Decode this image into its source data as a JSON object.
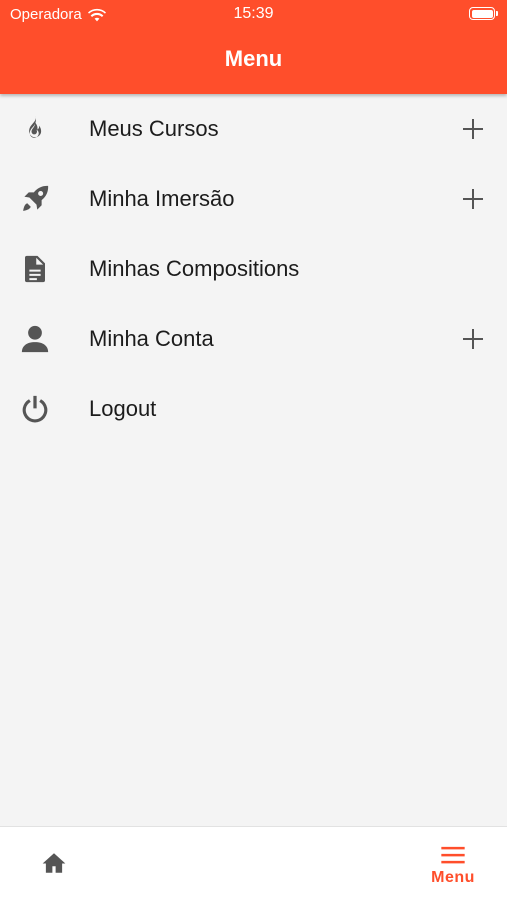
{
  "status_bar": {
    "carrier": "Operadora",
    "time": "15:39"
  },
  "header": {
    "title": "Menu"
  },
  "menu": {
    "items": [
      {
        "label": "Meus Cursos",
        "icon": "flame-icon",
        "expandable": true
      },
      {
        "label": "Minha Imersão",
        "icon": "rocket-icon",
        "expandable": true
      },
      {
        "label": "Minhas Compositions",
        "icon": "document-icon",
        "expandable": false
      },
      {
        "label": "Minha Conta",
        "icon": "user-icon",
        "expandable": true
      },
      {
        "label": "Logout",
        "icon": "power-icon",
        "expandable": false
      }
    ]
  },
  "tab_bar": {
    "home_icon": "home-icon",
    "menu_icon": "hamburger-icon",
    "menu_label": "Menu",
    "active": "menu"
  },
  "colors": {
    "accent": "#ff4e2b",
    "background": "#f4f4f4",
    "icon": "#555555",
    "text": "#1c1c1c"
  }
}
